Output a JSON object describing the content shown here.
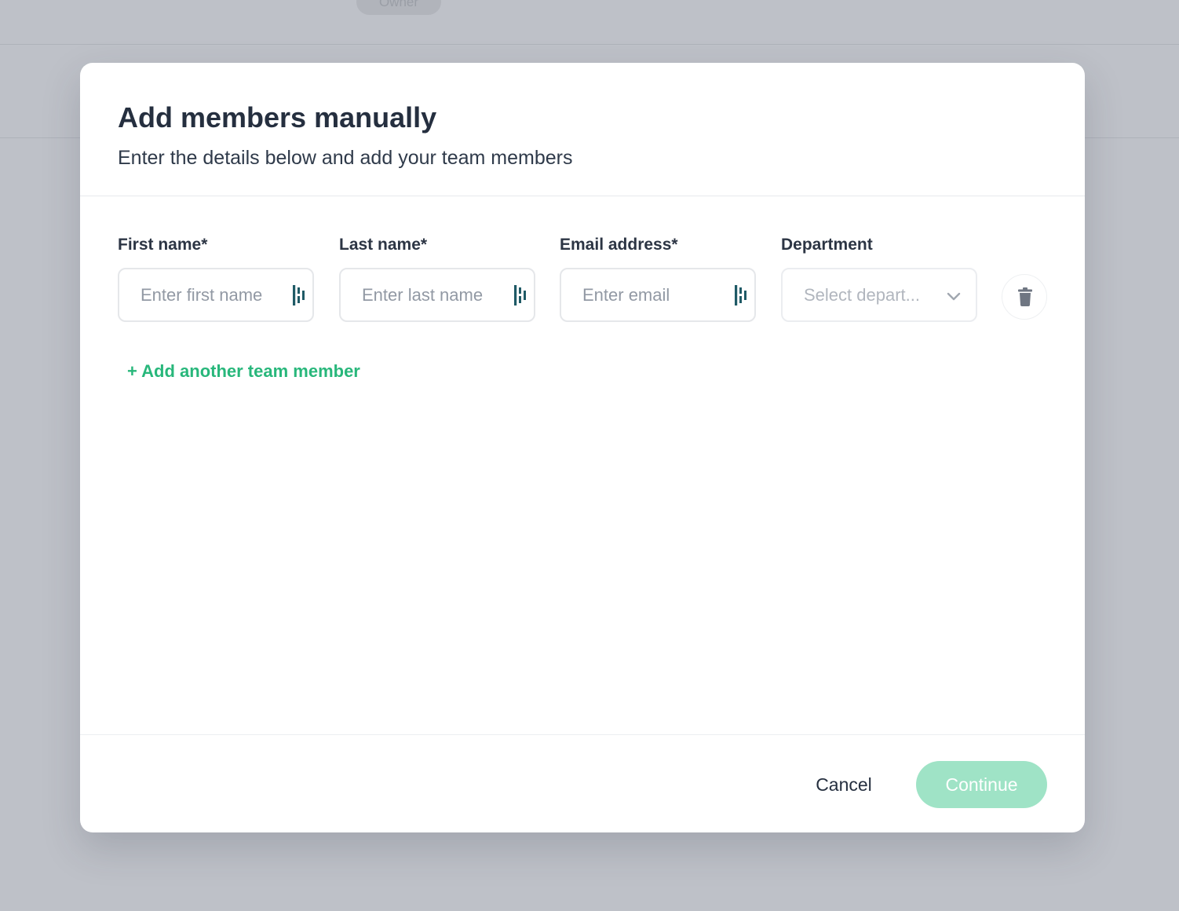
{
  "background": {
    "role_badge": "Owner"
  },
  "modal": {
    "title": "Add members manually",
    "subtitle": "Enter the details below and add your team members",
    "fields": {
      "first_name": {
        "label": "First name*",
        "placeholder": "Enter first name"
      },
      "last_name": {
        "label": "Last name*",
        "placeholder": "Enter last name"
      },
      "email": {
        "label": "Email address*",
        "placeholder": "Enter email"
      },
      "department": {
        "label": "Department",
        "placeholder": "Select depart..."
      }
    },
    "add_member_label": "+ Add another team member",
    "cancel_label": "Cancel",
    "continue_label": "Continue"
  },
  "colors": {
    "accent_green": "#28b77b",
    "continue_disabled": "#9fe3c6",
    "extension_icon": "#1f5a66",
    "backdrop": "#bec1c8"
  },
  "icons": {
    "field_extension": "password-manager-icon",
    "select": "chevron-down-icon",
    "delete": "trash-icon"
  }
}
